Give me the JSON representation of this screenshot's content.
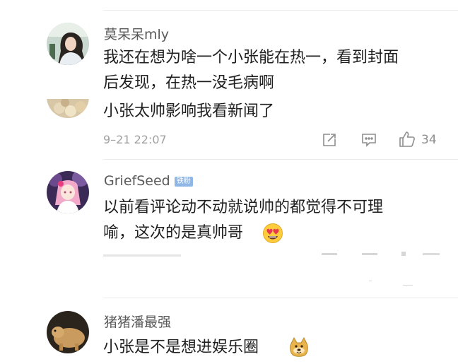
{
  "comments": [
    {
      "username": "莫呆呆mly",
      "lines": [
        "我还在想为啥一个小张能在热一，看到封面",
        "后发现，在热一没毛病啊"
      ],
      "avatar": "profile-photo-woman"
    },
    {
      "lines": [
        "小张太帅影响我看新闻了"
      ],
      "timestamp": "9–21 22:07",
      "likes": "34",
      "avatar": "profile-photo-food"
    },
    {
      "username": "GriefSeed",
      "badge": "铁粉",
      "lines": [
        "以前看评论动不动就说帅的都觉得不可理",
        "喻，这次的是真帅哥"
      ],
      "emoji": "heart-eyes-emoji",
      "avatar": "anime-girl-avatar"
    },
    {
      "username": "猪猪潘最强",
      "lines": [
        "小张是不是想进娱乐圈"
      ],
      "emoji": "doge-emoji",
      "avatar": "animal-photo-avatar"
    }
  ],
  "icons": {
    "share": "share-icon",
    "reply": "comment-icon",
    "like": "thumbs-up-icon"
  },
  "colors": {
    "text": "#1f1f1f",
    "username": "#5a5a5a",
    "meta": "#a0a0a0",
    "badge": "#8fb7e6"
  }
}
